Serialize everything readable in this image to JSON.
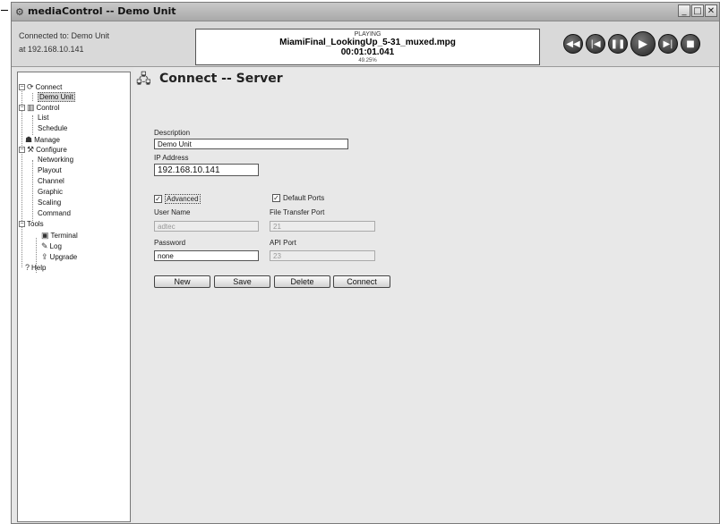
{
  "window": {
    "title": "mediaControl -- Demo Unit",
    "controls": [
      "_",
      "□",
      "✕"
    ]
  },
  "connection": {
    "line1": "Connected to: Demo Unit",
    "line2": "at 192.168.10.141"
  },
  "now_playing": {
    "status": "PLAYING",
    "filename": "MiamiFinal_LookingUp_5-31_muxed.mpg",
    "time": "00:01:01.041",
    "percent": "49.25%"
  },
  "transport": [
    {
      "name": "rewind",
      "glyph": "◀◀"
    },
    {
      "name": "previous",
      "glyph": "|◀"
    },
    {
      "name": "pause",
      "glyph": "❚❚"
    },
    {
      "name": "play",
      "glyph": "▶"
    },
    {
      "name": "next",
      "glyph": "▶|"
    },
    {
      "name": "stop",
      "glyph": "■"
    }
  ],
  "tree": {
    "connect": "Connect",
    "demo_unit": "Demo Unit",
    "control": "Control",
    "list": "List",
    "schedule": "Schedule",
    "manage": "Manage",
    "configure": "Configure",
    "networking": "Networking",
    "playout": "Playout",
    "channel": "Channel",
    "graphic": "Graphic",
    "scaling": "Scaling",
    "command": "Command",
    "tools": "Tools",
    "terminal": "Terminal",
    "log": "Log",
    "upgrade": "Upgrade",
    "help": "Help"
  },
  "page": {
    "title": "Connect -- Server",
    "description_label": "Description",
    "description_value": "Demo Unit",
    "ip_label": "IP Address",
    "ip_value": "192.168.10.141",
    "advanced_label": "Advanced",
    "advanced_checked": "✓",
    "default_ports_label": "Default Ports",
    "default_ports_checked": "✓",
    "username_label": "User Name",
    "username_value": "adtec",
    "ftp_label": "File Transfer Port",
    "ftp_value": "21",
    "password_label": "Password",
    "password_value": "none",
    "api_label": "API Port",
    "api_value": "23"
  },
  "buttons": {
    "new": "New",
    "save": "Save",
    "delete": "Delete",
    "connect": "Connect"
  }
}
